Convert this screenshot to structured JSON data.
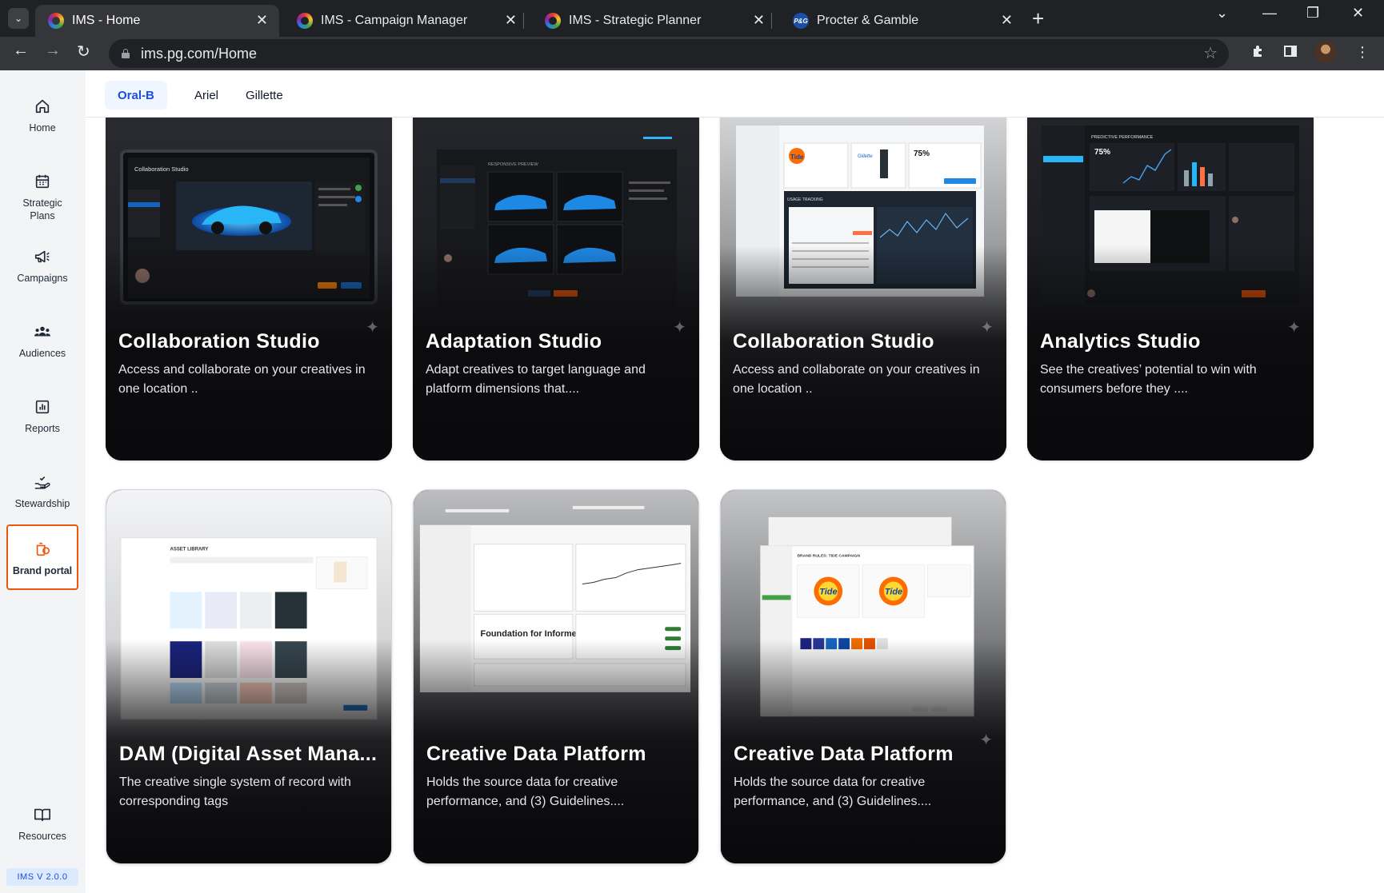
{
  "browser": {
    "tabs": [
      {
        "label": "IMS - Home",
        "icon": "ims-logo-icon"
      },
      {
        "label": "IMS - Campaign Manager",
        "icon": "ims-logo-icon"
      },
      {
        "label": "IMS - Strategic Planner",
        "icon": "ims-logo-icon"
      },
      {
        "label": "Procter & Gamble",
        "icon": "pg-logo-icon"
      }
    ],
    "url": "ims.pg.com/Home",
    "pg_favicon_text": "P&G"
  },
  "sidebar": {
    "items": [
      {
        "label": "Home",
        "icon": "home-icon"
      },
      {
        "label": "Strategic Plans",
        "icon": "calendar-icon"
      },
      {
        "label": "Campaigns",
        "icon": "megaphone-icon"
      },
      {
        "label": "Audiences",
        "icon": "people-icon"
      },
      {
        "label": "Reports",
        "icon": "bar-chart-icon"
      },
      {
        "label": "Stewardship",
        "icon": "hand-check-icon"
      },
      {
        "label": "Brand portal",
        "icon": "brand-portal-icon"
      },
      {
        "label": "Resources",
        "icon": "book-icon"
      }
    ],
    "active": "Brand portal",
    "version": "IMS V 2.0.0"
  },
  "brands": {
    "tabs": [
      "Oral-B",
      "Ariel",
      "Gillette"
    ],
    "active": "Oral-B"
  },
  "cards": [
    {
      "title": "Collaboration Studio",
      "desc": "Access and collaborate on your creatives in one location ..",
      "thumb_label": "Collaboration Studio"
    },
    {
      "title": "Adaptation Studio",
      "desc": "Adapt creatives to target language and platform dimensions that....",
      "thumb_label": "RESPONSIVE PREVIEW"
    },
    {
      "title": "Collaboration Studio",
      "desc": "Access and collaborate on your creatives in one location ..",
      "thumb_label": "USAGE TRACKING"
    },
    {
      "title": "Analytics Studio",
      "desc": "See the creatives’ potential to win with consumers before they ....",
      "thumb_label": "PREDICTIVE PERFORMANCE"
    },
    {
      "title": "DAM (Digital Asset Mana...",
      "desc": "The creative single system of record with corresponding tags",
      "thumb_label": "ASSET LIBRARY"
    },
    {
      "title": "Creative Data Platform",
      "desc": "Holds the source data for creative performance, and (3) Guidelines....",
      "thumb_label": "Foundation for Informed Creativity"
    },
    {
      "title": "Creative Data Platform",
      "desc": "Holds the source data for creative performance, and (3) Guidelines....",
      "thumb_label": "BRAND RULES: TIDE CAMPAIGN"
    }
  ],
  "thumb_text": {
    "pct": "75%",
    "tide": "Tide",
    "gillette": "Gillette"
  },
  "colors": {
    "accent": "#1d4ed8",
    "active_border": "#ea580c",
    "card_bg": "#0b0b0d"
  }
}
